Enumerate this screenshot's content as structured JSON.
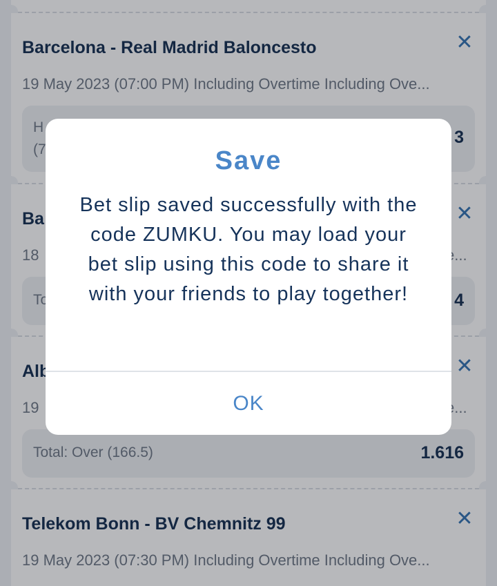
{
  "betslip": {
    "items": [
      {
        "title": "Barcelona - Real Madrid Baloncesto",
        "date": "19 May 2023 (07:00 PM) Including Overtime Including Ove...",
        "selection": "H",
        "selection_line2": "(7",
        "odds": "3"
      },
      {
        "title": "Ba",
        "date": "18",
        "selection": "To",
        "odds": "4"
      },
      {
        "title": "Alb",
        "date": "19",
        "selection": "Total: Over (166.5)",
        "odds": "1.616"
      },
      {
        "title": "Telekom Bonn - BV Chemnitz 99",
        "date": "19 May 2023 (07:30 PM) Including Overtime Including Ove..."
      }
    ],
    "close_glyph": "✕",
    "truncated_date_tail": "e..."
  },
  "dialog": {
    "title": "Save",
    "message": "Bet slip saved successfully with the code ZUMKU. You may load your bet slip using this code to share it with your friends to play together!",
    "ok_label": "OK"
  },
  "colors": {
    "accent": "#4a86c8",
    "title_text": "#0f2a4d",
    "overlay": "rgba(30,35,45,0.32)"
  }
}
